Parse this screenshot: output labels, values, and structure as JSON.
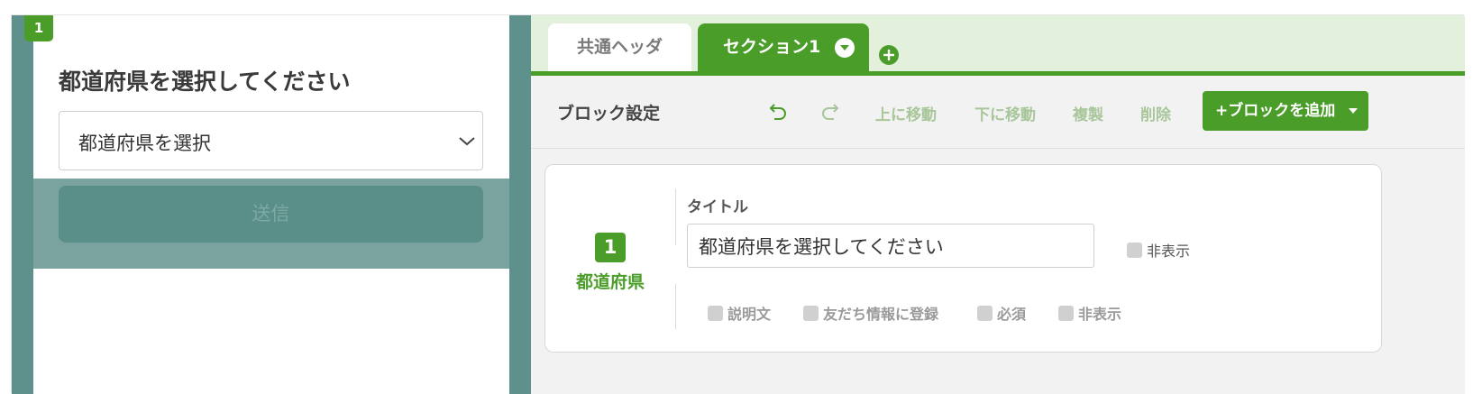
{
  "preview": {
    "block_number": "1",
    "title": "都道府県を選択してください",
    "select_placeholder": "都道府県を選択",
    "submit_label": "送信"
  },
  "tabs": [
    {
      "label": "共通ヘッダ",
      "active": false
    },
    {
      "label": "セクション1",
      "active": true
    }
  ],
  "toolbar": {
    "title": "ブロック設定",
    "move_up": "上に移動",
    "move_down": "下に移動",
    "duplicate": "複製",
    "delete": "削除",
    "add_block": "+ブロックを追加"
  },
  "block": {
    "number": "1",
    "type": "都道府県",
    "title_label": "タイトル",
    "title_value": "都道府県を選択してください",
    "hide_title_label": "非表示",
    "options": [
      "説明文",
      "友だち情報に登録",
      "必須",
      "非表示"
    ]
  },
  "colors": {
    "accent": "#4b9d2a",
    "preview_bg": "#5e918c",
    "tab_bar_bg": "#e3f0dc"
  }
}
